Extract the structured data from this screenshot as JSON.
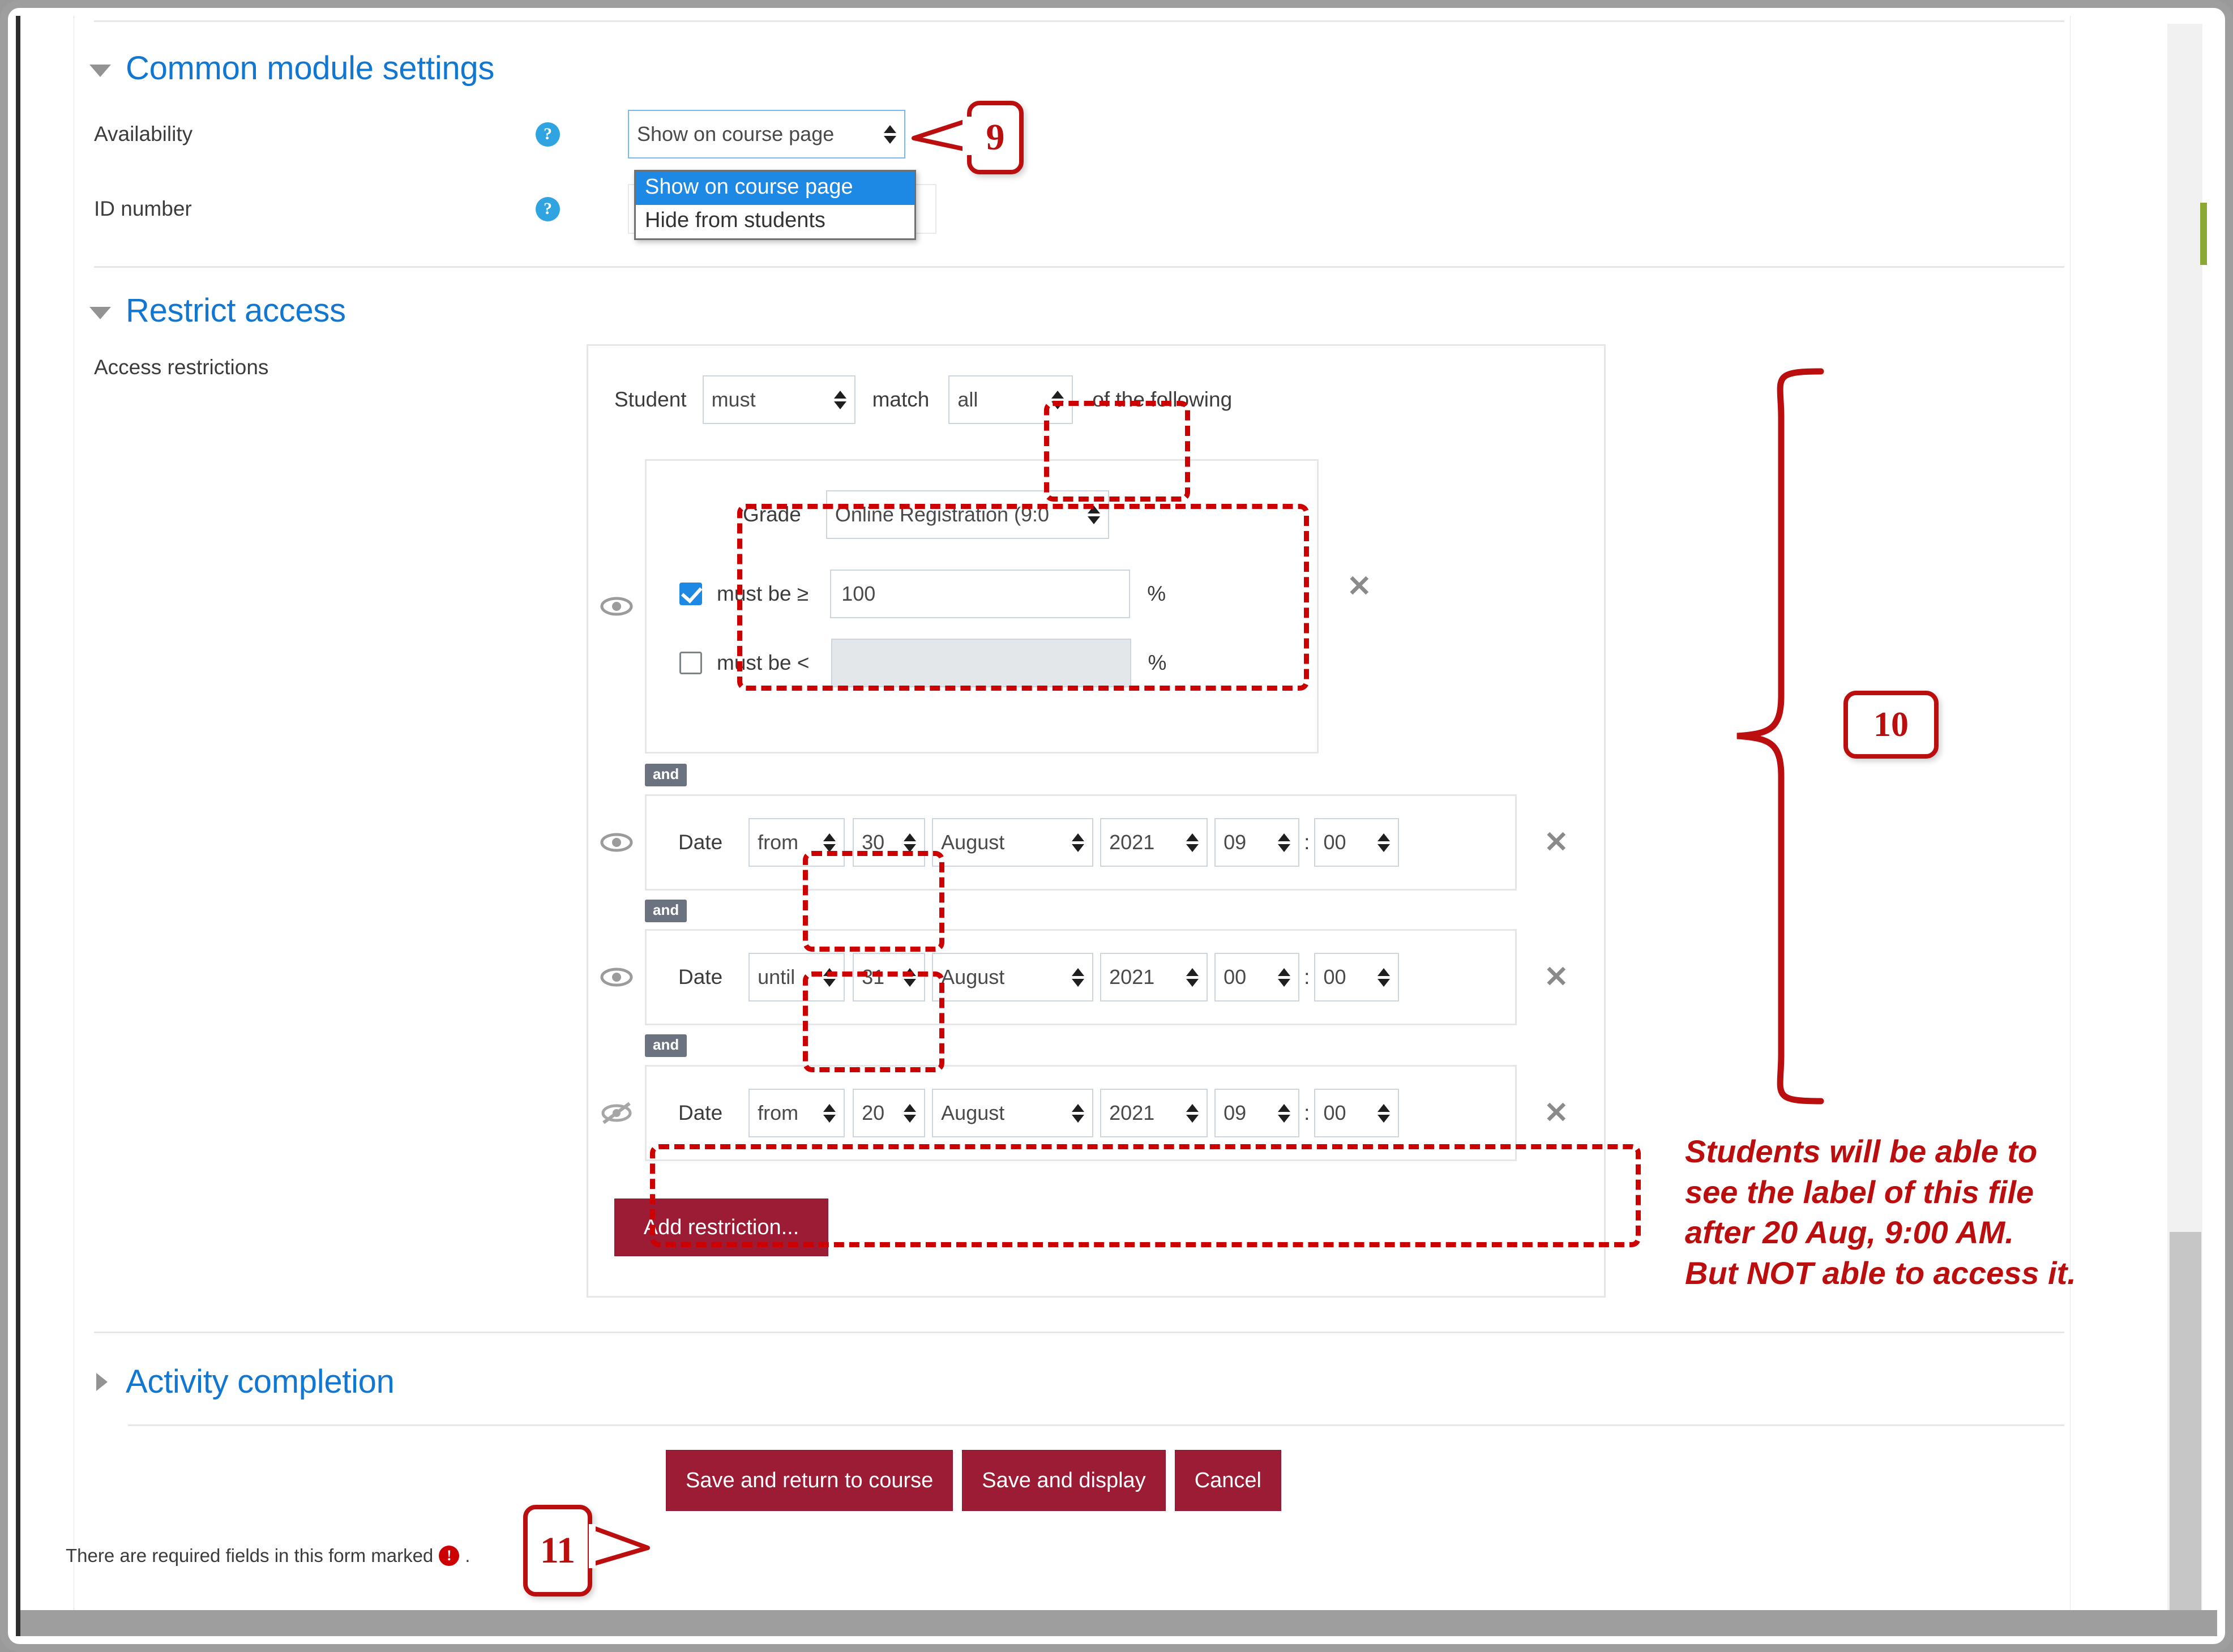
{
  "common_module": {
    "section_title": "Common module settings",
    "availability_label": "Availability",
    "availability_value": "Show on course page",
    "availability_options": [
      "Show on course page",
      "Hide from students"
    ],
    "availability_selected_index": 0,
    "id_number_label": "ID number",
    "help_icon": "?"
  },
  "restrict": {
    "section_title": "Restrict access",
    "access_restrictions_label": "Access restrictions",
    "student_label": "Student",
    "must_value": "must",
    "match_label": "match",
    "all_value": "all",
    "of_the_following_label": "of the following",
    "and_label": "and",
    "grade": {
      "label": "Grade",
      "item_value": "Online Registration (9:0",
      "must_be_gte_label": "must be ≥",
      "gte_value": "100",
      "gte_checked": true,
      "must_be_lt_label": "must be <",
      "lt_value": "",
      "lt_checked": false,
      "percent": "%"
    },
    "dates": [
      {
        "label": "Date",
        "direction": "from",
        "day": "30",
        "month": "August",
        "year": "2021",
        "hour": "09",
        "minute": "00",
        "separator": ":",
        "eye": "eye-visible"
      },
      {
        "label": "Date",
        "direction": "until",
        "day": "31",
        "month": "August",
        "year": "2021",
        "hour": "00",
        "minute": "00",
        "separator": ":",
        "eye": "eye-visible"
      },
      {
        "label": "Date",
        "direction": "from",
        "day": "20",
        "month": "August",
        "year": "2021",
        "hour": "09",
        "minute": "00",
        "separator": ":",
        "eye": "eye-hidden"
      }
    ],
    "add_restriction_label": "Add restriction..."
  },
  "activity_completion": {
    "section_title": "Activity completion"
  },
  "form_actions": {
    "save_return_label": "Save and return to course",
    "save_display_label": "Save and display",
    "cancel_label": "Cancel"
  },
  "footer": {
    "required_text_before": "There are required fields in this form marked",
    "required_text_after": ".",
    "required_icon": "!"
  },
  "annotations": {
    "callout_9": "9",
    "callout_10": "10",
    "callout_11": "11",
    "note_lines": [
      "Students will be able to",
      "see the label of this file",
      "after 20 Aug, 9:00 AM.",
      "But NOT able to access it."
    ],
    "accent_red": "#bb0e0e",
    "dashed_red": "#cc0000",
    "brand_maroon": "#9c1b35",
    "link_blue": "#1177d1"
  }
}
